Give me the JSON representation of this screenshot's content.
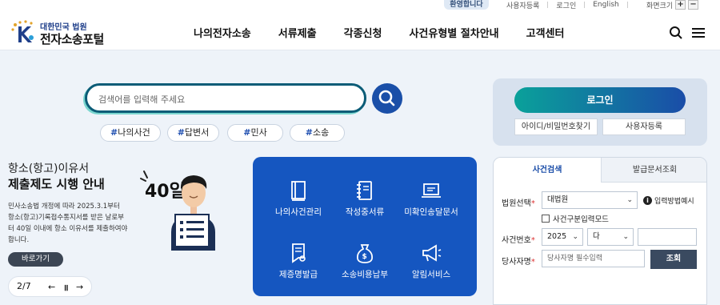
{
  "utility": {
    "welcome": "환영합니다",
    "links": [
      "사용자등록",
      "로그인",
      "English"
    ],
    "fontsize_label": "화면크기",
    "plus": "+",
    "minus": "−"
  },
  "header": {
    "logo_sub": "대한민국 법원",
    "logo_main": "전자소송포털",
    "nav": [
      "나의전자소송",
      "서류제출",
      "각종신청",
      "사건유형별 절차안내",
      "고객센터"
    ]
  },
  "search": {
    "placeholder": "검색어를 입력해 주세요",
    "tags": [
      "나의사건",
      "답변서",
      "민사",
      "소송"
    ]
  },
  "login": {
    "login_label": "로그인",
    "find_label": "아이디/비밀번호찾기",
    "register_label": "사용자등록"
  },
  "banner": {
    "title1": "항소(항고)이유서",
    "title2": "제출제도 시행 안내",
    "days": "40일",
    "desc": "민사소송법 개정에 따라 2025.3.1부터 항소(항고)기록접수통지서를 받은 날로부터 40일 이내에 항소 이유서를 제출하여야 합니다.",
    "more_label": "바로가기",
    "pager": "2/7"
  },
  "services": [
    {
      "label": "나의사건관리",
      "icon": "book-icon"
    },
    {
      "label": "작성중서류",
      "icon": "notebook-icon"
    },
    {
      "label": "미확인송달문서",
      "icon": "laptop-icon"
    },
    {
      "label": "제증명발급",
      "icon": "certificate-icon"
    },
    {
      "label": "소송비용납부",
      "icon": "money-bag-icon"
    },
    {
      "label": "알림서비스",
      "icon": "megaphone-icon"
    }
  ],
  "case_search": {
    "tab_active": "사건검색",
    "tab_inactive": "발급문서조회",
    "court_label": "법원선택",
    "court_value": "대법원",
    "input_method": "입력방법예시",
    "no_case_type": "사건구분입력모드",
    "case_no_label": "사건번호",
    "year_value": "2025",
    "type_value": "다",
    "party_label": "당사자명",
    "party_placeholder": "당사자명 필수입력",
    "query_label": "조회"
  },
  "colors": {
    "primary": "#1556c0",
    "search_border": "#0b5c77",
    "login_gradient_start": "#0aa19a",
    "login_gradient_end": "#1a4da8"
  }
}
